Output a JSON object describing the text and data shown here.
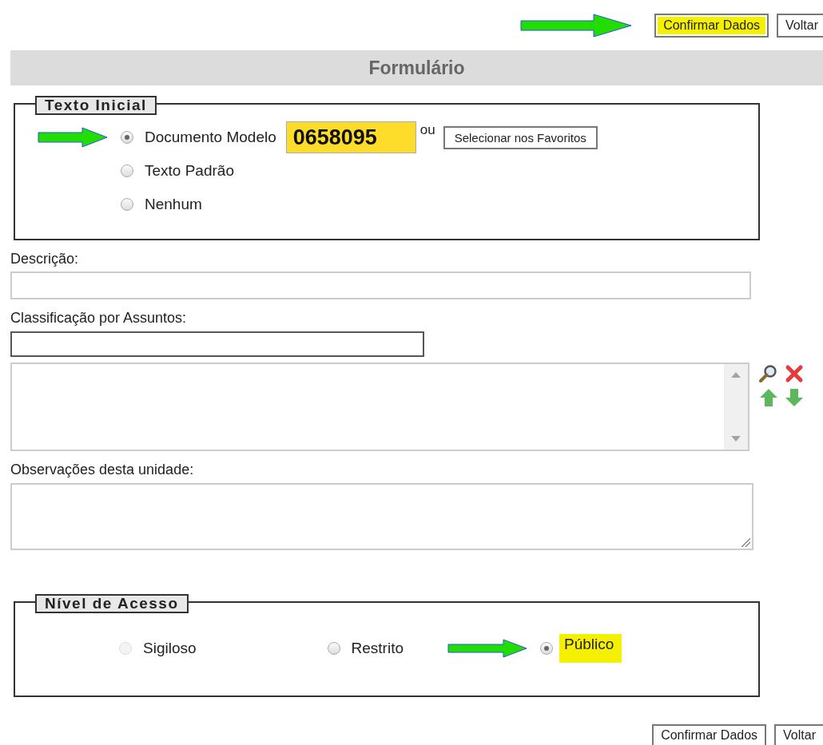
{
  "top_buttons": [
    {
      "label": "Confirmar Dados",
      "highlighted": true
    },
    {
      "label": "Voltar",
      "highlighted": false
    }
  ],
  "title": "Formulário",
  "texto_inicial": {
    "legend": "Texto Inicial",
    "options": [
      {
        "label": "Documento Modelo",
        "selected": true,
        "arrow": true
      },
      {
        "label": "Texto Padrão",
        "selected": false,
        "arrow": false
      },
      {
        "label": "Nenhum",
        "selected": false,
        "arrow": false
      }
    ],
    "document_number": {
      "value": "0658095",
      "highlighted": true
    },
    "or_text": "ou",
    "favorites_button": "Selecionar nos Favoritos"
  },
  "descricao": {
    "label": "Descrição:"
  },
  "classificacao": {
    "label": "Classificação por Assuntos:"
  },
  "observacoes": {
    "label": "Observações desta unidade:"
  },
  "nivel_acesso": {
    "legend": "Nível de Acesso",
    "options": [
      {
        "label": "Sigiloso",
        "selected": false,
        "disabled": true,
        "highlighted": false,
        "arrow": false
      },
      {
        "label": "Restrito",
        "selected": false,
        "disabled": false,
        "highlighted": false,
        "arrow": false
      },
      {
        "label": "Público",
        "selected": true,
        "disabled": false,
        "highlighted": true,
        "arrow": true
      }
    ]
  },
  "bottom_buttons": [
    {
      "label": "Confirmar Dados",
      "highlighted": false
    },
    {
      "label": "Voltar",
      "highlighted": false
    }
  ]
}
